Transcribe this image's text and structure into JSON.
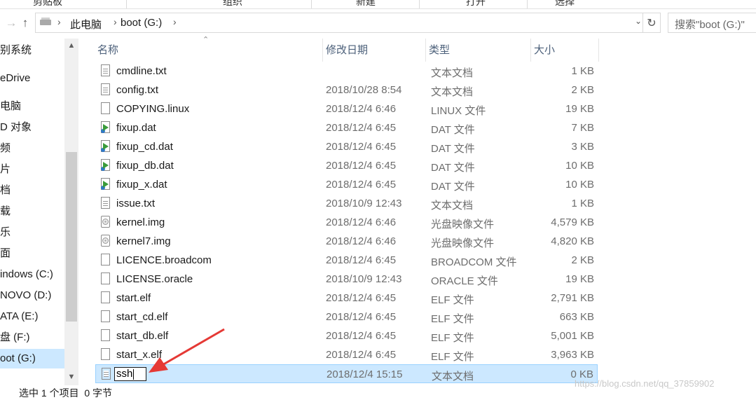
{
  "ribbon": {
    "groups": [
      "剪贴板",
      "组织",
      "新建",
      "打开",
      "选择"
    ]
  },
  "address": {
    "breadcrumb": [
      "此电脑",
      "boot (G:)"
    ],
    "search_placeholder": "搜索\"boot (G:)\""
  },
  "nav": {
    "items": [
      {
        "label": "别系统"
      },
      {
        "label": "eDrive"
      },
      {
        "label": "电脑"
      },
      {
        "label": "D 对象"
      },
      {
        "label": "频"
      },
      {
        "label": "片"
      },
      {
        "label": "档"
      },
      {
        "label": "载"
      },
      {
        "label": "乐"
      },
      {
        "label": "面"
      },
      {
        "label": "indows (C:)"
      },
      {
        "label": "NOVO (D:)"
      },
      {
        "label": "ATA (E:)"
      },
      {
        "label": "盘 (F:)"
      },
      {
        "label": "oot (G:)",
        "selected": true
      }
    ]
  },
  "columns": {
    "name": "名称",
    "date": "修改日期",
    "type": "类型",
    "size": "大小"
  },
  "files": [
    {
      "name": "cmdline.txt",
      "date": "",
      "type": "文本文档",
      "size": "1 KB",
      "icon": "text-file-icon"
    },
    {
      "name": "config.txt",
      "date": "2018/10/28 8:54",
      "type": "文本文档",
      "size": "2 KB",
      "icon": "text-file-icon"
    },
    {
      "name": "COPYING.linux",
      "date": "2018/12/4 6:46",
      "type": "LINUX 文件",
      "size": "19 KB",
      "icon": "blank-file-icon"
    },
    {
      "name": "fixup.dat",
      "date": "2018/12/4 6:45",
      "type": "DAT 文件",
      "size": "7 KB",
      "icon": "media-file-icon"
    },
    {
      "name": "fixup_cd.dat",
      "date": "2018/12/4 6:45",
      "type": "DAT 文件",
      "size": "3 KB",
      "icon": "media-file-icon"
    },
    {
      "name": "fixup_db.dat",
      "date": "2018/12/4 6:45",
      "type": "DAT 文件",
      "size": "10 KB",
      "icon": "media-file-icon"
    },
    {
      "name": "fixup_x.dat",
      "date": "2018/12/4 6:45",
      "type": "DAT 文件",
      "size": "10 KB",
      "icon": "media-file-icon"
    },
    {
      "name": "issue.txt",
      "date": "2018/10/9 12:43",
      "type": "文本文档",
      "size": "1 KB",
      "icon": "text-file-icon"
    },
    {
      "name": "kernel.img",
      "date": "2018/12/4 6:46",
      "type": "光盘映像文件",
      "size": "4,579 KB",
      "icon": "disc-image-icon"
    },
    {
      "name": "kernel7.img",
      "date": "2018/12/4 6:46",
      "type": "光盘映像文件",
      "size": "4,820 KB",
      "icon": "disc-image-icon"
    },
    {
      "name": "LICENCE.broadcom",
      "date": "2018/12/4 6:45",
      "type": "BROADCOM 文件",
      "size": "2 KB",
      "icon": "blank-file-icon"
    },
    {
      "name": "LICENSE.oracle",
      "date": "2018/10/9 12:43",
      "type": "ORACLE 文件",
      "size": "19 KB",
      "icon": "blank-file-icon"
    },
    {
      "name": "start.elf",
      "date": "2018/12/4 6:45",
      "type": "ELF 文件",
      "size": "2,791 KB",
      "icon": "blank-file-icon"
    },
    {
      "name": "start_cd.elf",
      "date": "2018/12/4 6:45",
      "type": "ELF 文件",
      "size": "663 KB",
      "icon": "blank-file-icon"
    },
    {
      "name": "start_db.elf",
      "date": "2018/12/4 6:45",
      "type": "ELF 文件",
      "size": "5,001 KB",
      "icon": "blank-file-icon"
    },
    {
      "name": "start_x.elf",
      "date": "2018/12/4 6:45",
      "type": "ELF 文件",
      "size": "3,963 KB",
      "icon": "blank-file-icon"
    },
    {
      "name": "ssh",
      "date": "2018/12/4 15:15",
      "type": "文本文档",
      "size": "0 KB",
      "icon": "text-file-icon",
      "renaming": true
    }
  ],
  "status": "选中 1 个项目  0 字节",
  "watermark": "https://blog.csdn.net/qq_37859902",
  "colors": {
    "selection": "#cce8ff",
    "selection_border": "#99d1ff",
    "arrow": "#e53935"
  }
}
